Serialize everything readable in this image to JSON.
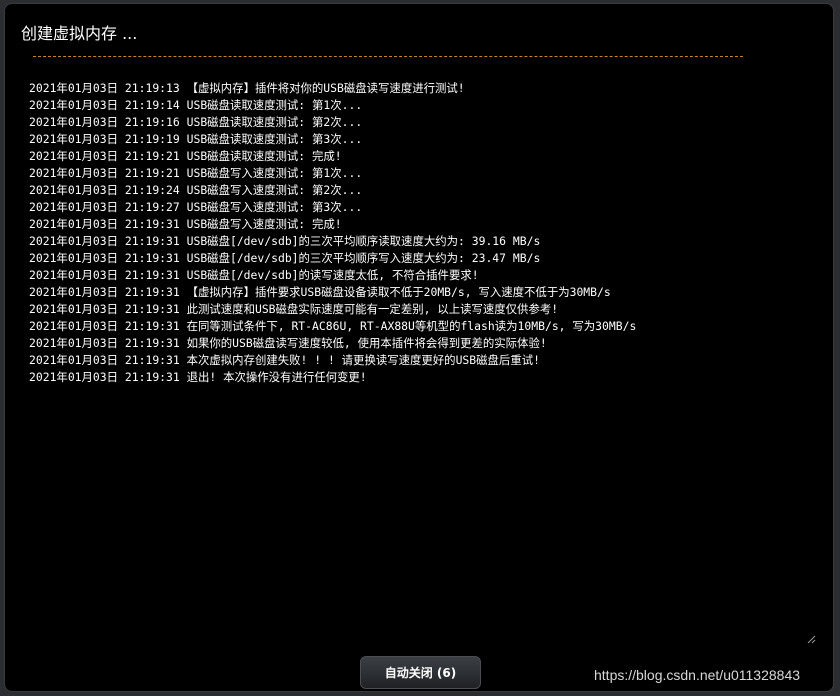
{
  "dialog": {
    "title": "创建虚拟内存 ...",
    "close_button_label": "自动关闭 (6)"
  },
  "log": [
    "2021年01月03日 21:19:13 【虚拟内存】插件将对你的USB磁盘读写速度进行测试!",
    "2021年01月03日 21:19:14 USB磁盘读取速度测试: 第1次...",
    "2021年01月03日 21:19:16 USB磁盘读取速度测试: 第2次...",
    "2021年01月03日 21:19:19 USB磁盘读取速度测试: 第3次...",
    "2021年01月03日 21:19:21 USB磁盘读取速度测试: 完成!",
    "2021年01月03日 21:19:21 USB磁盘写入速度测试: 第1次...",
    "2021年01月03日 21:19:24 USB磁盘写入速度测试: 第2次...",
    "2021年01月03日 21:19:27 USB磁盘写入速度测试: 第3次...",
    "2021年01月03日 21:19:31 USB磁盘写入速度测试: 完成!",
    "2021年01月03日 21:19:31 USB磁盘[/dev/sdb]的三次平均顺序读取速度大约为: 39.16 MB/s",
    "2021年01月03日 21:19:31 USB磁盘[/dev/sdb]的三次平均顺序写入速度大约为: 23.47 MB/s",
    "2021年01月03日 21:19:31 USB磁盘[/dev/sdb]的读写速度太低, 不符合插件要求!",
    "2021年01月03日 21:19:31 【虚拟内存】插件要求USB磁盘设备读取不低于20MB/s, 写入速度不低于为30MB/s",
    "2021年01月03日 21:19:31 此测试速度和USB磁盘实际速度可能有一定差别, 以上读写速度仅供参考!",
    "2021年01月03日 21:19:31 在同等测试条件下, RT-AC86U, RT-AX88U等机型的flash读为10MB/s, 写为30MB/s",
    "2021年01月03日 21:19:31 如果你的USB磁盘读写速度较低, 使用本插件将会得到更差的实际体验!",
    "2021年01月03日 21:19:31 本次虚拟内存创建失败! ! ! 请更换读写速度更好的USB磁盘后重试!",
    "2021年01月03日 21:19:31 退出! 本次操作没有进行任何变更!"
  ],
  "watermark": "https://blog.csdn.net/u011328843",
  "colors": {
    "background": "#000000",
    "divider": "#c8822a",
    "text": "#ffffff"
  },
  "icons": {
    "resize_grip": "resize-grip-icon"
  }
}
